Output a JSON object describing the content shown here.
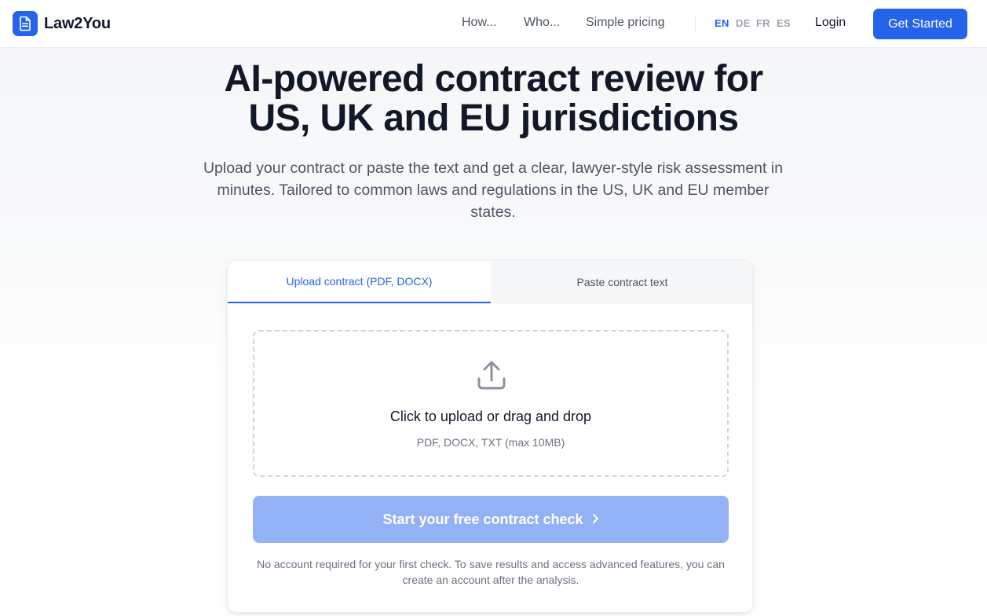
{
  "header": {
    "brand": "Law2You",
    "nav": [
      {
        "label": "How..."
      },
      {
        "label": "Who..."
      },
      {
        "label": "Simple pricing"
      }
    ],
    "languages": [
      {
        "code": "EN",
        "active": true
      },
      {
        "code": "DE",
        "active": false
      },
      {
        "code": "FR",
        "active": false
      },
      {
        "code": "ES",
        "active": false
      }
    ],
    "login_label": "Login",
    "cta_label": "Get Started"
  },
  "hero": {
    "title_line1": "AI-powered contract review for",
    "title_line2": "US, UK and EU jurisdictions",
    "subtitle": "Upload your contract or paste the text and get a clear, lawyer-style risk assessment in minutes. Tailored to common laws and regulations in the US, UK and EU member states."
  },
  "card": {
    "tabs": [
      {
        "label": "Upload contract (PDF, DOCX)",
        "active": true
      },
      {
        "label": "Paste contract text",
        "active": false
      }
    ],
    "dropzone": {
      "icon": "upload-icon",
      "title": "Click to upload or drag and drop",
      "hint": "PDF, DOCX, TXT (max 10MB)"
    },
    "submit_label": "Start your free contract check",
    "submit_icon": "chevron-right-icon",
    "footnote": "No account required for your first check. To save results and access advanced features, you can create an account after the analysis."
  },
  "colors": {
    "accent": "#2563eb",
    "disabled_button": "#93b1f5",
    "text_primary": "#111827",
    "text_muted": "#6b7280"
  }
}
